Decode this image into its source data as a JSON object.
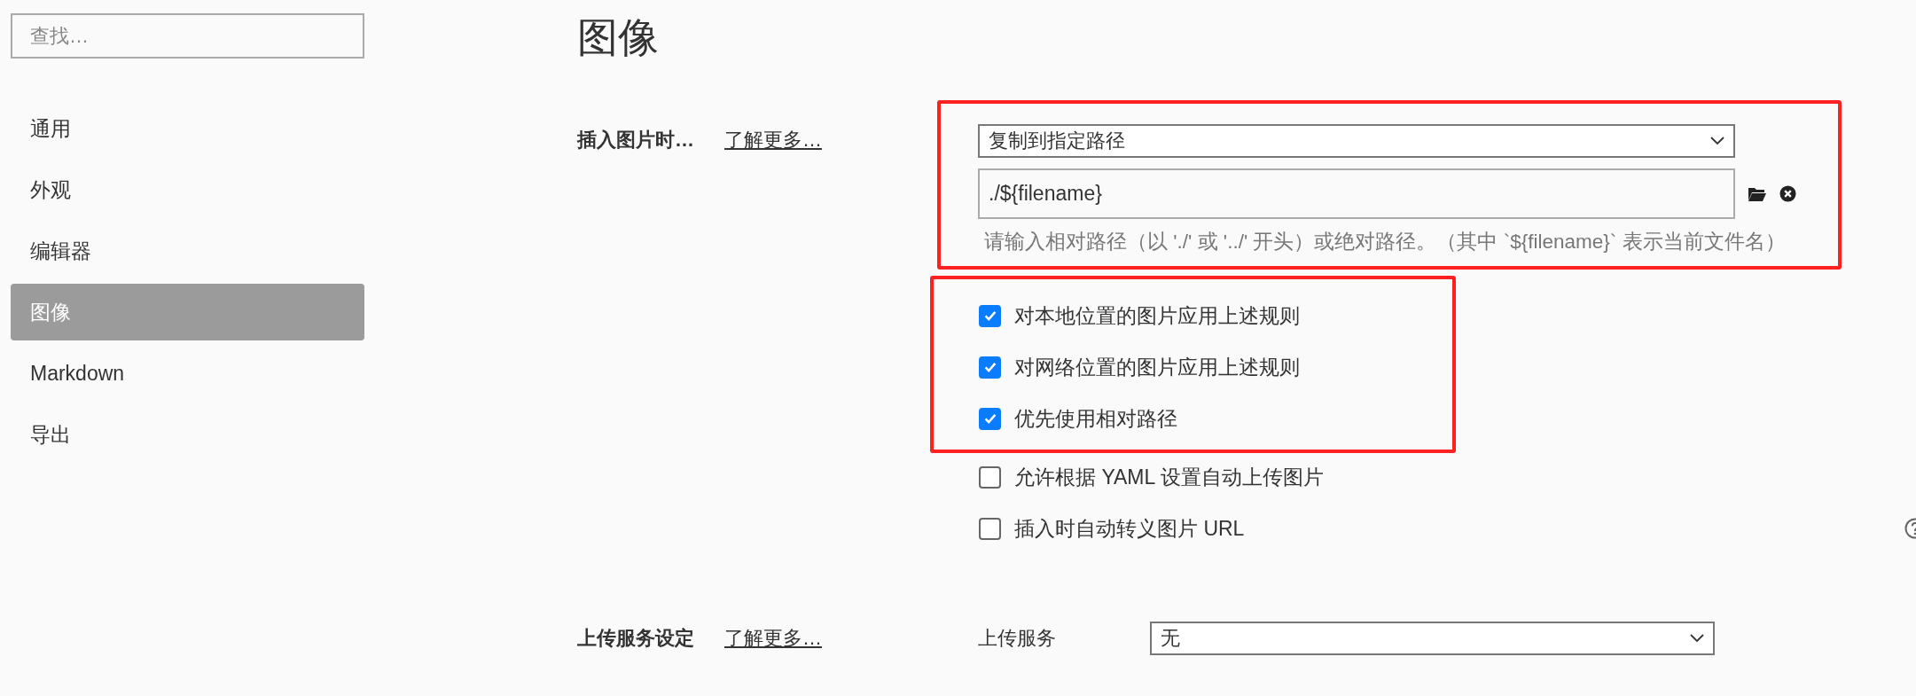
{
  "sidebar": {
    "search": {
      "placeholder": "查找…"
    },
    "items": [
      {
        "label": "通用",
        "selected": false
      },
      {
        "label": "外观",
        "selected": false
      },
      {
        "label": "编辑器",
        "selected": false
      },
      {
        "label": "图像",
        "selected": true
      },
      {
        "label": "Markdown",
        "selected": false
      },
      {
        "label": "导出",
        "selected": false
      }
    ]
  },
  "page": {
    "title": "图像"
  },
  "insert_section": {
    "label": "插入图片时…",
    "link": "了解更多…",
    "highlighted": true,
    "action_select": {
      "value": "复制到指定路径"
    },
    "path_field": {
      "value": "./${filename}"
    },
    "hint": "请输入相对路径（以 './' 或 '../' 开头）或绝对路径。（其中 `${filename}` 表示当前文件名）"
  },
  "rule_group": {
    "highlighted": true,
    "options": [
      {
        "label": "对本地位置的图片应用上述规则",
        "checked": true
      },
      {
        "label": "对网络位置的图片应用上述规则",
        "checked": true
      },
      {
        "label": "优先使用相对路径",
        "checked": true
      }
    ]
  },
  "options": [
    {
      "label": "允许根据 YAML 设置自动上传图片",
      "checked": false
    },
    {
      "label": "插入时自动转义图片 URL",
      "checked": false
    }
  ],
  "upload_section": {
    "label": "上传服务设定",
    "link": "了解更多…",
    "field_label": "上传服务",
    "service_select": {
      "value": "无"
    }
  }
}
